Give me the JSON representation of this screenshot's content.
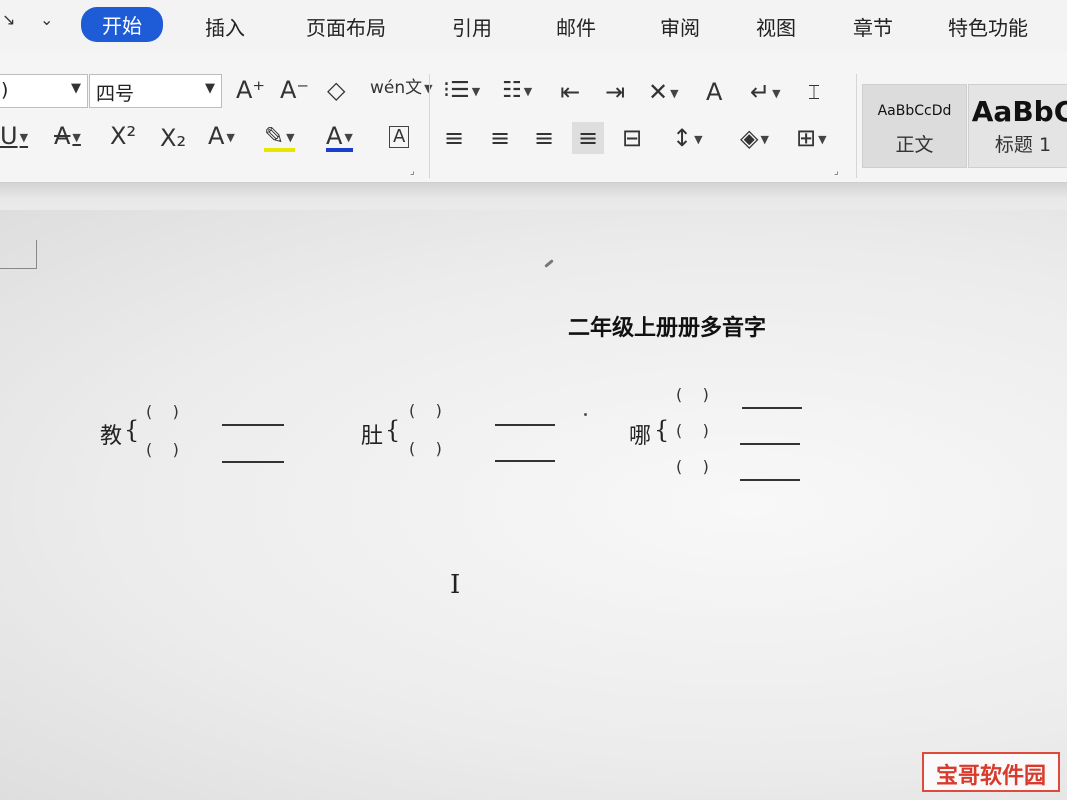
{
  "tabs": [
    {
      "label": "开始",
      "active": true
    },
    {
      "label": "插入"
    },
    {
      "label": "页面布局"
    },
    {
      "label": "引用"
    },
    {
      "label": "邮件"
    },
    {
      "label": "审阅"
    },
    {
      "label": "视图"
    },
    {
      "label": "章节"
    },
    {
      "label": "特色功能"
    }
  ],
  "quick_access": {
    "left": "↘",
    "dropdown": "⌄"
  },
  "font": {
    "size": "四号"
  },
  "ribbon_glyphs": {
    "grow_font": "A⁺",
    "shrink_font": "A⁻",
    "clear_format": "◇",
    "pinyin": "wén文",
    "underline": "U",
    "strikethrough": "A",
    "superscript": "X²",
    "subscript": "X₂",
    "text_effect": "A",
    "highlight": "✎",
    "font_color": "A",
    "char_border": "A",
    "bullets": "⁝☰",
    "numbering": "☷",
    "decrease_indent": "⇤",
    "increase_indent": "⇥",
    "cn_layout": "✕",
    "text_direction": "A",
    "line_break": "↵",
    "ruler": "⌶",
    "align_left": "≡",
    "align_center": "≡",
    "align_right": "≡",
    "justify": "≡",
    "distributed": "⊟",
    "line_spacing": "↕",
    "shading": "◈",
    "borders": "⊞"
  },
  "styles": [
    {
      "preview": "AaBbCcDd",
      "name": "正文"
    },
    {
      "preview": "AaBbC",
      "name": "标题 1"
    }
  ],
  "document": {
    "title": "二年级上册册多音字",
    "items": [
      {
        "char": "教",
        "brace": "{",
        "rows": [
          "(    )",
          "(    )"
        ]
      },
      {
        "char": "肚",
        "brace": "{",
        "rows": [
          "(    )",
          "(    )"
        ]
      },
      {
        "char": "哪",
        "brace": "{",
        "rows": [
          "(    )",
          "(    )",
          "(    )"
        ]
      }
    ],
    "cursor": "I"
  },
  "watermark": "宝哥软件园"
}
